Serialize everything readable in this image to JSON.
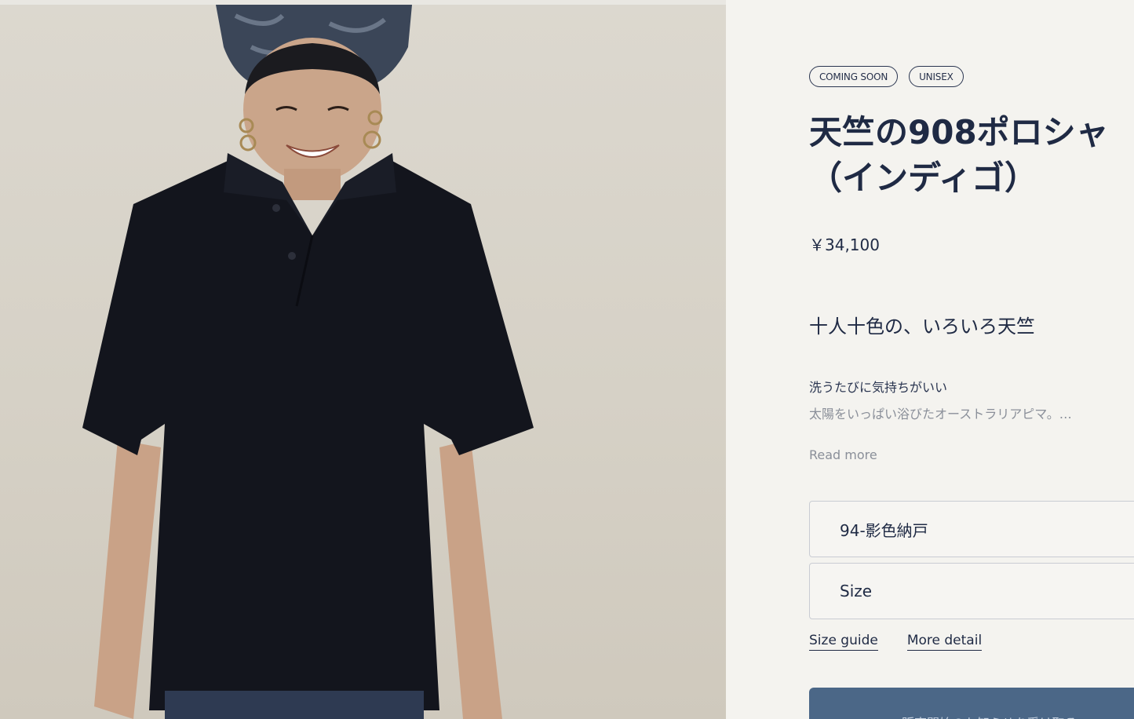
{
  "product": {
    "badges": [
      "COMING SOON",
      "UNISEX"
    ],
    "title_line1": "天竺の908ポロシャ",
    "title_line2": "（インディゴ）",
    "price": "￥34,100",
    "catchcopy": "十人十色の、いろいろ天竺",
    "description_heading": "洗うたびに気持ちがいい",
    "description_excerpt": "太陽をいっぱい浴びたオーストラリアピマ。…",
    "read_more_label": "Read more"
  },
  "options": {
    "color_selected": "94-影色納戸",
    "size_label": "Size"
  },
  "links": {
    "size_guide": "Size guide",
    "more_detail": "More detail"
  },
  "cta": {
    "label": "販売開始のお知らせを受け取る"
  },
  "colors": {
    "ink": "#1f2a44",
    "cta": "#4b6787",
    "background": "#f4f3ef"
  }
}
